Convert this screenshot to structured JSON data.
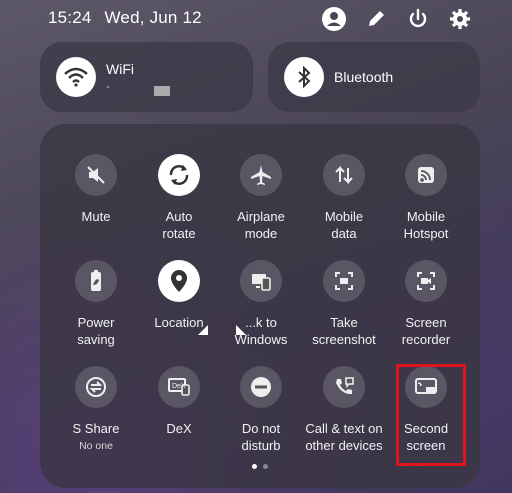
{
  "status": {
    "time": "15:24",
    "date": "Wed, Jun 12"
  },
  "top_icons": [
    "user-icon",
    "edit-icon",
    "power-icon",
    "settings-icon"
  ],
  "wifi": {
    "label": "WiFi",
    "sub": "-"
  },
  "bluetooth": {
    "label": "Bluetooth"
  },
  "tiles": [
    {
      "label": "Mute",
      "icon": "mute-icon",
      "active": false
    },
    {
      "label": "Auto\nrotate",
      "icon": "auto-rotate-icon",
      "active": true
    },
    {
      "label": "Airplane\nmode",
      "icon": "airplane-icon",
      "active": false
    },
    {
      "label": "Mobile\ndata",
      "icon": "mobile-data-icon",
      "active": false
    },
    {
      "label": "Mobile\nHotspot",
      "icon": "hotspot-icon",
      "active": false
    },
    {
      "label": "Power\nsaving",
      "icon": "power-saving-icon",
      "active": false
    },
    {
      "label": "Location",
      "icon": "location-icon",
      "active": true
    },
    {
      "label": "...k to\nWindows",
      "icon": "link-windows-icon",
      "active": false
    },
    {
      "label": "Take\nscreenshot",
      "icon": "screenshot-icon",
      "active": false
    },
    {
      "label": "Screen\nrecorder",
      "icon": "screen-recorder-icon",
      "active": false
    },
    {
      "label": "S Share",
      "sub": "No one",
      "icon": "s-share-icon",
      "active": false
    },
    {
      "label": "DeX",
      "icon": "dex-icon",
      "active": false
    },
    {
      "label": "Do not\ndisturb",
      "icon": "do-not-disturb-icon",
      "active": false
    },
    {
      "label": "Call & text on\nother devices",
      "icon": "call-text-icon",
      "active": false
    },
    {
      "label": "Second\nscreen",
      "icon": "second-screen-icon",
      "active": false
    }
  ],
  "page_dots": {
    "count": 2,
    "current": 0
  }
}
